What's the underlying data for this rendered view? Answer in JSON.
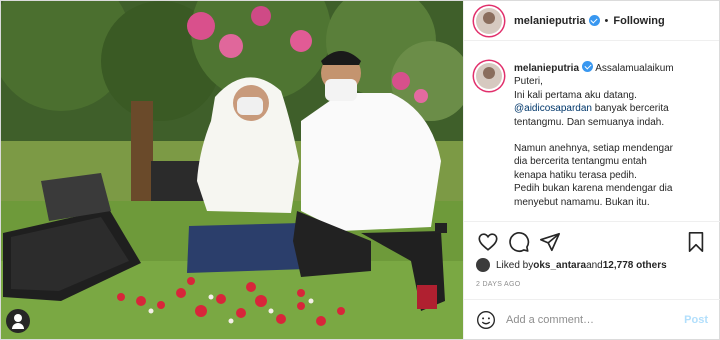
{
  "post": {
    "username": "melanieputria",
    "follow_status": "Following",
    "separator": "•",
    "caption": {
      "username": "melanieputria",
      "line1": "Assalamualaikum",
      "line2": "Puteri,",
      "line3": "Ini kali pertama aku datang.",
      "mention": "@aidicosapardan",
      "line4_rest": " banyak bercerita",
      "line5": "tentangmu. Dan semuanya indah.",
      "line6": "Namun anehnya, setiap mendengar",
      "line7": "dia bercerita tentangmu entah",
      "line8": "kenapa hatiku terasa pedih.",
      "line9": "Pedih bukan karena mendengar dia",
      "line10": "menyebut namamu. Bukan itu."
    },
    "likes": {
      "prefix": "Liked by ",
      "user": "oks_antara",
      "middle": " and ",
      "count": "12,778 others"
    },
    "timestamp": "2 DAYS AGO",
    "comment_box": {
      "placeholder": "Add a comment…",
      "post_label": "Post"
    },
    "colors": {
      "verified": "#3897f0",
      "link": "#00376b",
      "post_disabled": "#b2dffc"
    },
    "icons": [
      "heart-icon",
      "comment-icon",
      "share-icon",
      "bookmark-icon",
      "emoji-icon",
      "verified-icon",
      "tagged-user-icon"
    ]
  }
}
